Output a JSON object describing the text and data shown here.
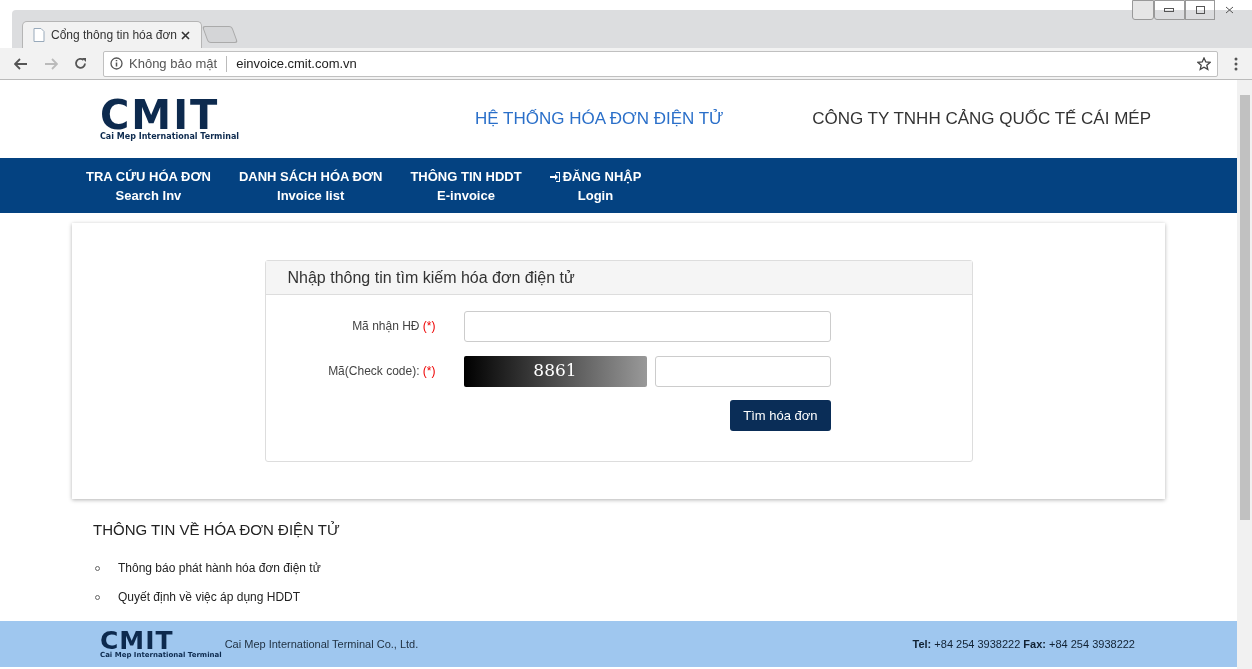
{
  "browser": {
    "tab_title": "Cổng thông tin hóa đơn",
    "security_label": "Không bảo mật",
    "url": "einvoice.cmit.com.vn"
  },
  "header": {
    "logo_text": "CMIT",
    "logo_subtitle": "Cai Mep International Terminal",
    "system_title": "HỆ THỐNG HÓA ĐƠN ĐIỆN TỬ",
    "company_name": "CÔNG TY TNHH CẢNG QUỐC TẾ CÁI MÉP"
  },
  "nav": [
    {
      "label": "TRA CỨU HÓA ĐƠN",
      "sublabel": "Search Inv",
      "kind": "plain"
    },
    {
      "label": "DANH SÁCH HÓA ĐƠN",
      "sublabel": "Invoice list",
      "kind": "plain"
    },
    {
      "label": "THÔNG TIN HDDT",
      "sublabel": "E-invoice",
      "kind": "plain"
    },
    {
      "label": "ĐĂNG NHẬP",
      "sublabel": "Login",
      "kind": "login"
    }
  ],
  "search_panel": {
    "title": "Nhập thông tin tìm kiếm hóa đơn điện tử",
    "invoice_code_label": "Mã nhận HĐ",
    "check_code_label": "Mã(Check code):",
    "required_mark": "(*)",
    "captcha_text": "8861",
    "submit_button": "Tìm hóa đơn"
  },
  "info": {
    "heading": "THÔNG TIN VỀ HÓA ĐƠN ĐIỆN TỬ",
    "items": [
      "Thông báo phát hành hóa đơn điện tử",
      "Quyết định về việc áp dụng HDDT"
    ]
  },
  "footer": {
    "logo_text": "CMIT",
    "logo_subtitle": "Cai Mep International Terminal",
    "company": "Cai Mep International Terminal Co., Ltd.",
    "contact": "**Tel:** +84 254 3938222 **Fax:** +84 254 3938222"
  }
}
